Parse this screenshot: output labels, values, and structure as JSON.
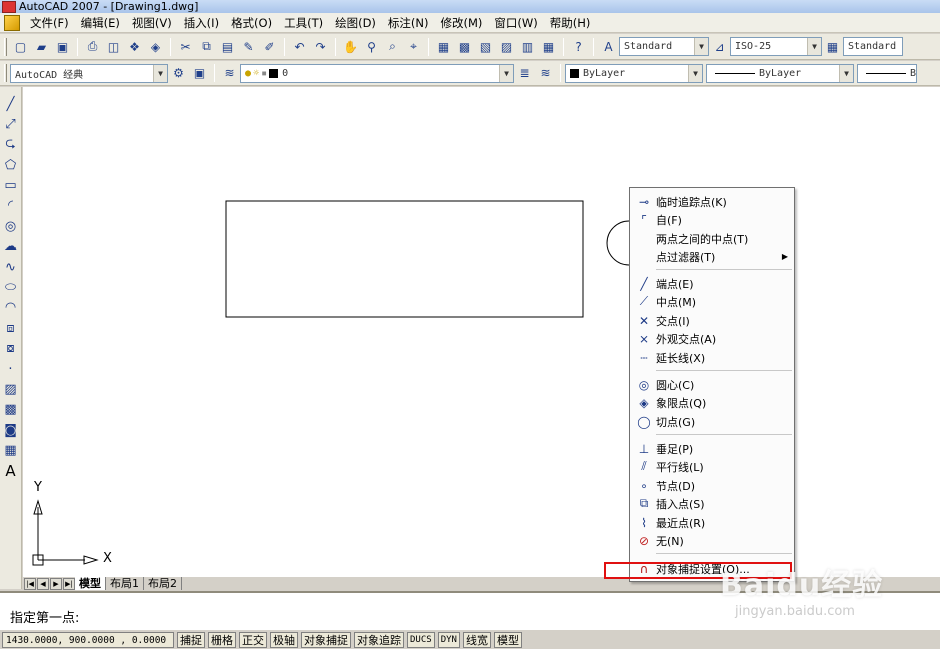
{
  "window": {
    "title": "AutoCAD 2007 - [Drawing1.dwg]"
  },
  "menu": [
    "文件(F)",
    "编辑(E)",
    "视图(V)",
    "插入(I)",
    "格式(O)",
    "工具(T)",
    "绘图(D)",
    "标注(N)",
    "修改(M)",
    "窗口(W)",
    "帮助(H)"
  ],
  "toolbar": {
    "text_style": "Standard",
    "dim_style": "ISO-25",
    "table_style": "Standard",
    "workspace": "AutoCAD 经典",
    "layer": "0",
    "color": "ByLayer",
    "linetype": "ByLayer",
    "lineweight": "B"
  },
  "canvas": {
    "ucs_x": "X",
    "ucs_y": "Y"
  },
  "tabs": [
    "模型",
    "布局1",
    "布局2"
  ],
  "command": {
    "prompt": "指定第一点:"
  },
  "status": {
    "coords": "1430.0000, 900.0000 , 0.0000",
    "buttons": [
      "捕捉",
      "栅格",
      "正交",
      "极轴",
      "对象捕捉",
      "对象追踪",
      "DUCS",
      "DYN",
      "线宽",
      "模型"
    ]
  },
  "context_menu": {
    "items": [
      {
        "label": "临时追踪点(K)",
        "icon": "temp-track-icon"
      },
      {
        "label": "自(F)",
        "icon": "from-icon"
      },
      {
        "label": "两点之间的中点(T)",
        "icon": ""
      },
      {
        "label": "点过滤器(T)",
        "icon": "",
        "submenu": true
      },
      {
        "label": "端点(E)",
        "icon": "endpoint-icon"
      },
      {
        "label": "中点(M)",
        "icon": "midpoint-icon"
      },
      {
        "label": "交点(I)",
        "icon": "intersection-icon"
      },
      {
        "label": "外观交点(A)",
        "icon": "apparent-intersection-icon"
      },
      {
        "label": "延长线(X)",
        "icon": "extension-icon"
      },
      {
        "label": "圆心(C)",
        "icon": "center-icon"
      },
      {
        "label": "象限点(Q)",
        "icon": "quadrant-icon"
      },
      {
        "label": "切点(G)",
        "icon": "tangent-icon"
      },
      {
        "label": "垂足(P)",
        "icon": "perpendicular-icon"
      },
      {
        "label": "平行线(L)",
        "icon": "parallel-icon"
      },
      {
        "label": "节点(D)",
        "icon": "node-icon"
      },
      {
        "label": "插入点(S)",
        "icon": "insert-icon"
      },
      {
        "label": "最近点(R)",
        "icon": "nearest-icon"
      },
      {
        "label": "无(N)",
        "icon": "none-icon"
      },
      {
        "label": "对象捕捉设置(O)...",
        "icon": "osnap-settings-icon"
      }
    ]
  },
  "watermark": {
    "text": "Baidu经验",
    "url": "jingyan.baidu.com"
  }
}
